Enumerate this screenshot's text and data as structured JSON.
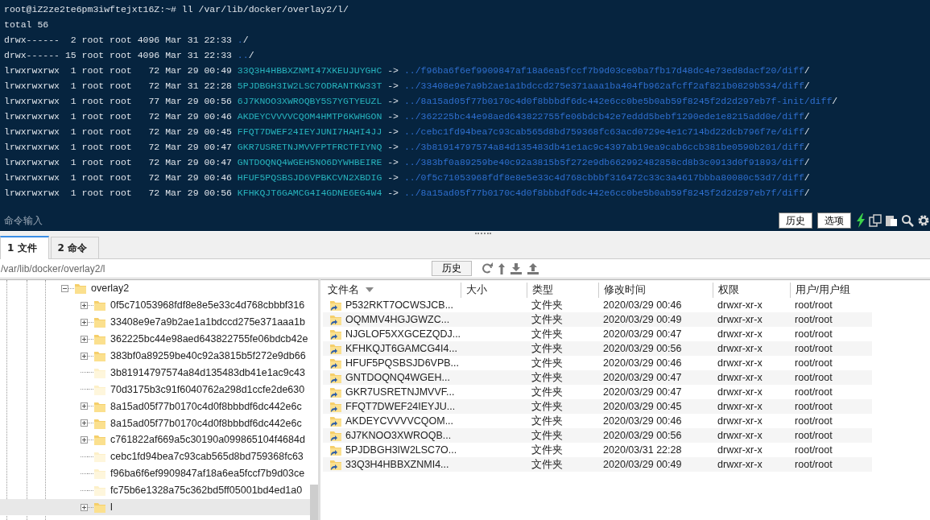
{
  "terminal": {
    "lines": [
      {
        "segments": [
          {
            "kind": "plain",
            "text": "root@iZ2ze2te6pm3iwftejxt16Z:~# ll /var/lib/docker/overlay2/l/"
          }
        ]
      },
      {
        "segments": [
          {
            "kind": "plain",
            "text": "total 56"
          }
        ]
      },
      {
        "segments": [
          {
            "kind": "plain",
            "text": "drwx------  2 root root 4096 Mar 31 22:33 "
          },
          {
            "kind": "dir",
            "text": "."
          },
          {
            "kind": "plain",
            "text": "/"
          }
        ]
      },
      {
        "segments": [
          {
            "kind": "plain",
            "text": "drwx------ 15 root root 4096 Mar 31 22:33 "
          },
          {
            "kind": "dir",
            "text": ".."
          },
          {
            "kind": "plain",
            "text": "/"
          }
        ]
      },
      {
        "segments": [
          {
            "kind": "plain",
            "text": "lrwxrwxrwx  1 root root   72 Mar 29 00:49 "
          },
          {
            "kind": "link",
            "text": "33Q3H4HBBXZNMI47XKEUJUYGHC"
          },
          {
            "kind": "plain",
            "text": " -> "
          },
          {
            "kind": "dir",
            "text": "../f96ba6f6ef9909847af18a6ea5fccf7b9d03ce0ba7fb17d48dc4e73ed8dacf20/diff"
          },
          {
            "kind": "plain",
            "text": "/"
          }
        ]
      },
      {
        "segments": [
          {
            "kind": "plain",
            "text": "lrwxrwxrwx  1 root root   72 Mar 31 22:28 "
          },
          {
            "kind": "link",
            "text": "5PJDBGH3IW2LSC7ODRANTKW33T"
          },
          {
            "kind": "plain",
            "text": " -> "
          },
          {
            "kind": "dir",
            "text": "../33408e9e7a9b2ae1a1bdccd275e371aaa1ba404fb962afcff2af821b0829b534/diff"
          },
          {
            "kind": "plain",
            "text": "/"
          }
        ]
      },
      {
        "segments": [
          {
            "kind": "plain",
            "text": "lrwxrwxrwx  1 root root   77 Mar 29 00:56 "
          },
          {
            "kind": "link",
            "text": "6J7KNOO3XWROQBY5S7YGTYEUZL"
          },
          {
            "kind": "plain",
            "text": " -> "
          },
          {
            "kind": "dir",
            "text": "../8a15ad05f77b0170c4d0f8bbbdf6dc442e6cc0be5b0ab59f8245f2d2d297eb7f-init/diff"
          },
          {
            "kind": "plain",
            "text": "/"
          }
        ]
      },
      {
        "segments": [
          {
            "kind": "plain",
            "text": "lrwxrwxrwx  1 root root   72 Mar 29 00:46 "
          },
          {
            "kind": "link",
            "text": "AKDEYCVVVVCQOM4HMTP6KWHGON"
          },
          {
            "kind": "plain",
            "text": " -> "
          },
          {
            "kind": "dir",
            "text": "../362225bc44e98aed643822755fe06bdcb42e7eddd5bebf1290ede1e8215add0e/diff"
          },
          {
            "kind": "plain",
            "text": "/"
          }
        ]
      },
      {
        "segments": [
          {
            "kind": "plain",
            "text": "lrwxrwxrwx  1 root root   72 Mar 29 00:45 "
          },
          {
            "kind": "link",
            "text": "FFQT7DWEF24IEYJUNI7HAHI4JJ"
          },
          {
            "kind": "plain",
            "text": " -> "
          },
          {
            "kind": "dir",
            "text": "../cebc1fd94bea7c93cab565d8bd759368fc63acd0729e4e1c714bd22dcb796f7e/diff"
          },
          {
            "kind": "plain",
            "text": "/"
          }
        ]
      },
      {
        "segments": [
          {
            "kind": "plain",
            "text": "lrwxrwxrwx  1 root root   72 Mar 29 00:47 "
          },
          {
            "kind": "link",
            "text": "GKR7USRETNJMVVFPTFRCTFIYNQ"
          },
          {
            "kind": "plain",
            "text": " -> "
          },
          {
            "kind": "dir",
            "text": "../3b81914797574a84d135483db41e1ac9c4397ab19ea9cab6ccb381be0590b201/diff"
          },
          {
            "kind": "plain",
            "text": "/"
          }
        ]
      },
      {
        "segments": [
          {
            "kind": "plain",
            "text": "lrwxrwxrwx  1 root root   72 Mar 29 00:47 "
          },
          {
            "kind": "link",
            "text": "GNTDOQNQ4WGEH5NO6DYWHBEIRE"
          },
          {
            "kind": "plain",
            "text": " -> "
          },
          {
            "kind": "dir",
            "text": "../383bf0a89259be40c92a3815b5f272e9db662992482858cd8b3c0913d0f91893/diff"
          },
          {
            "kind": "plain",
            "text": "/"
          }
        ]
      },
      {
        "segments": [
          {
            "kind": "plain",
            "text": "lrwxrwxrwx  1 root root   72 Mar 29 00:46 "
          },
          {
            "kind": "link",
            "text": "HFUF5PQSBSJD6VPBKCVN2XBDIG"
          },
          {
            "kind": "plain",
            "text": " -> "
          },
          {
            "kind": "dir",
            "text": "../0f5c71053968fdf8e8e5e33c4d768cbbbf316472c33c3a4617bbba80080c53d7/diff"
          },
          {
            "kind": "plain",
            "text": "/"
          }
        ]
      },
      {
        "segments": [
          {
            "kind": "plain",
            "text": "lrwxrwxrwx  1 root root   72 Mar 29 00:56 "
          },
          {
            "kind": "link",
            "text": "KFHKQJT6GAMCG4I4GDNE6EG4W4"
          },
          {
            "kind": "plain",
            "text": " -> "
          },
          {
            "kind": "dir",
            "text": "../8a15ad05f77b0170c4d0f8bbbdf6dc442e6cc0be5b0ab59f8245f2d2d297eb7f/diff"
          },
          {
            "kind": "plain",
            "text": "/"
          }
        ]
      }
    ]
  },
  "command_bar": {
    "placeholder": "命令输入",
    "buttons": [
      "历史",
      "选项"
    ]
  },
  "tabs": [
    {
      "label": "1 文件",
      "selected": true
    },
    {
      "label": "2 命令",
      "selected": false
    }
  ],
  "path_bar": {
    "value": "/var/lib/docker/overlay2/l",
    "button": "历史"
  },
  "tree": {
    "items": [
      {
        "label": "overlay2",
        "expanded": true,
        "selected": false,
        "children": [
          {
            "label": "0f5c71053968fdf8e8e5e33c4d768cbbbf316",
            "expandable": true,
            "selected": false
          },
          {
            "label": "33408e9e7a9b2ae1a1bdccd275e371aaa1b",
            "expandable": true,
            "selected": false
          },
          {
            "label": "362225bc44e98aed643822755fe06bdcb42e",
            "expandable": true,
            "selected": false
          },
          {
            "label": "383bf0a89259be40c92a3815b5f272e9db66",
            "expandable": true,
            "selected": false
          },
          {
            "label": "3b81914797574a84d135483db41e1ac9c43",
            "expandable": false,
            "selected": false
          },
          {
            "label": "70d3175b3c91f6040762a298d1ccfe2de630",
            "expandable": false,
            "selected": false
          },
          {
            "label": "8a15ad05f77b0170c4d0f8bbbdf6dc442e6c",
            "expandable": true,
            "selected": false
          },
          {
            "label": "8a15ad05f77b0170c4d0f8bbbdf6dc442e6c",
            "expandable": true,
            "selected": false
          },
          {
            "label": "c761822af669a5c30190a099865104f4684d",
            "expandable": true,
            "selected": false
          },
          {
            "label": "cebc1fd94bea7c93cab565d8bd759368fc63",
            "expandable": false,
            "selected": false
          },
          {
            "label": "f96ba6f6ef9909847af18a6ea5fccf7b9d03ce",
            "expandable": false,
            "selected": false
          },
          {
            "label": "fc75b6e1328a75c362bd5ff05001bd4ed1a0",
            "expandable": false,
            "selected": false
          },
          {
            "label": "l",
            "expandable": true,
            "selected": true
          }
        ]
      }
    ]
  },
  "file_list": {
    "columns": [
      {
        "label": "文件名",
        "sorted": true
      },
      {
        "label": "大小",
        "sorted": false
      },
      {
        "label": "类型",
        "sorted": false
      },
      {
        "label": "修改时间",
        "sorted": false
      },
      {
        "label": "权限",
        "sorted": false
      },
      {
        "label": "用户/用户组",
        "sorted": false
      }
    ],
    "rows": [
      {
        "name": "P532RKT7OCWSJCB...",
        "type": "文件夹",
        "modified": "2020/03/29 00:46",
        "permissions": "drwxr-xr-x",
        "owner": "root/root"
      },
      {
        "name": "OQMMV4HGJGWZC...",
        "type": "文件夹",
        "modified": "2020/03/29 00:49",
        "permissions": "drwxr-xr-x",
        "owner": "root/root"
      },
      {
        "name": "NJGLOF5XXGCEZQDJ...",
        "type": "文件夹",
        "modified": "2020/03/29 00:47",
        "permissions": "drwxr-xr-x",
        "owner": "root/root"
      },
      {
        "name": "KFHKQJT6GAMCG4I4...",
        "type": "文件夹",
        "modified": "2020/03/29 00:56",
        "permissions": "drwxr-xr-x",
        "owner": "root/root"
      },
      {
        "name": "HFUF5PQSBSJD6VPB...",
        "type": "文件夹",
        "modified": "2020/03/29 00:46",
        "permissions": "drwxr-xr-x",
        "owner": "root/root"
      },
      {
        "name": "GNTDOQNQ4WGEH...",
        "type": "文件夹",
        "modified": "2020/03/29 00:47",
        "permissions": "drwxr-xr-x",
        "owner": "root/root"
      },
      {
        "name": "GKR7USRETNJMVVF...",
        "type": "文件夹",
        "modified": "2020/03/29 00:47",
        "permissions": "drwxr-xr-x",
        "owner": "root/root"
      },
      {
        "name": "FFQT7DWEF24IEYJU...",
        "type": "文件夹",
        "modified": "2020/03/29 00:45",
        "permissions": "drwxr-xr-x",
        "owner": "root/root"
      },
      {
        "name": "AKDEYCVVVVCQOM...",
        "type": "文件夹",
        "modified": "2020/03/29 00:46",
        "permissions": "drwxr-xr-x",
        "owner": "root/root"
      },
      {
        "name": "6J7KNOO3XWROQB...",
        "type": "文件夹",
        "modified": "2020/03/29 00:56",
        "permissions": "drwxr-xr-x",
        "owner": "root/root"
      },
      {
        "name": "5PJDBGH3IW2LSC7O...",
        "type": "文件夹",
        "modified": "2020/03/31 22:28",
        "permissions": "drwxr-xr-x",
        "owner": "root/root"
      },
      {
        "name": "33Q3H4HBBXZNMI4...",
        "type": "文件夹",
        "modified": "2020/03/29 00:49",
        "permissions": "drwxr-xr-x",
        "owner": "root/root"
      }
    ]
  }
}
